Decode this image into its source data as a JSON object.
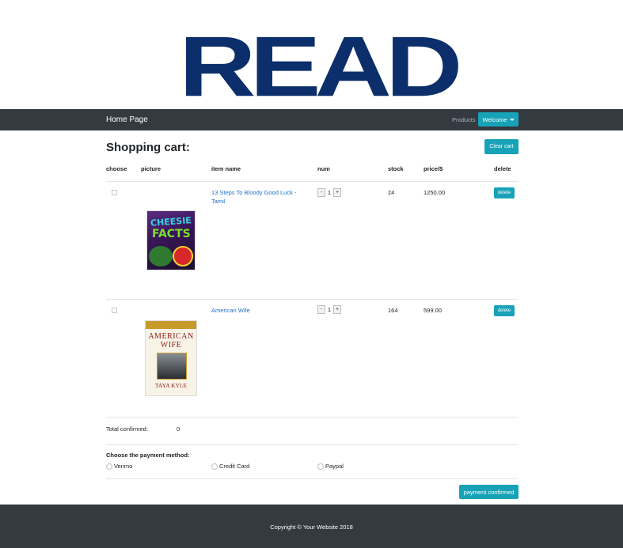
{
  "brand": {
    "logo_text": "READ"
  },
  "navbar": {
    "home_label": "Home Page",
    "products_label": "Products",
    "welcome_label": "Welcome"
  },
  "cart": {
    "title": "Shopping cart:",
    "clear_label": "Clear cart",
    "columns": [
      "choose",
      "picture",
      "item name",
      "num",
      "stock",
      "price/$",
      "delete"
    ],
    "rows": [
      {
        "item_name": "13 Steps To Bloody Good Luck - Tamil",
        "num": "1",
        "stock": "24",
        "price": "1250.00",
        "delete_label": "delete",
        "cover": {
          "line1": "CHEESIE",
          "line2": "FACTS"
        }
      },
      {
        "item_name": "American Wife",
        "num": "1",
        "stock": "164",
        "price": "599.00",
        "delete_label": "delete",
        "cover": {
          "line1": "AMERICAN",
          "line2": "WIFE",
          "author": "TAYA KYLE"
        }
      }
    ],
    "minus_label": "-",
    "plus_label": "+"
  },
  "total": {
    "label": "Total confirmed:",
    "value": "0"
  },
  "payment": {
    "title": "Choose the payment method:",
    "options": [
      "Venmo",
      "Credit Card",
      "Paypal"
    ],
    "confirm_label": "payment confirmed"
  },
  "footer": {
    "text": "Copyright © Your Website 2018"
  },
  "colors": {
    "navbar": "#343a40",
    "accent": "#17a2b8",
    "link": "#1a73c8",
    "logo": "#0c2e6b"
  }
}
